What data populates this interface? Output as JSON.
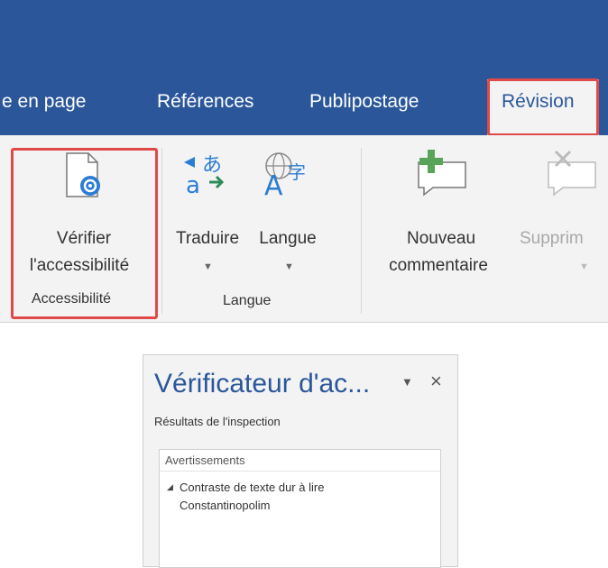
{
  "tabs": [
    "e en page",
    "Références",
    "Publipostage",
    "Révision"
  ],
  "ribbon": {
    "accessibility": {
      "button_line1": "Vérifier",
      "button_line2": "l'accessibilité",
      "group_label": "Accessibilité"
    },
    "language": {
      "translate_label": "Traduire",
      "language_label": "Langue",
      "group_label": "Langue"
    },
    "comments": {
      "new_line1": "Nouveau",
      "new_line2": "commentaire",
      "delete_label": "Supprim"
    }
  },
  "pane": {
    "title": "Vérificateur d'ac...",
    "menu_glyph": "▼",
    "close_glyph": "×",
    "subtitle": "Résultats de l'inspection",
    "section_header": "Avertissements",
    "item_line1": "Contraste de texte dur à lire",
    "item_line2": "Constantinopolim"
  },
  "colors": {
    "accent": "#2b579a",
    "highlight": "#e0494a",
    "ribbon_bg": "#f3f3f3",
    "green": "#5aa35a"
  }
}
